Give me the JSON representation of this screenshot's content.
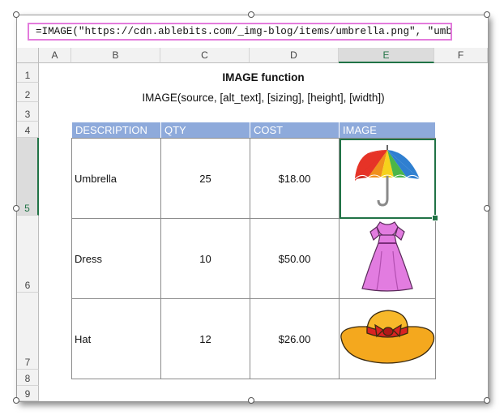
{
  "formula_bar": {
    "text": "=IMAGE(\"https://cdn.ablebits.com/_img-blog/items/umbrella.png\", \"umbrella\")"
  },
  "columns": [
    "A",
    "B",
    "C",
    "D",
    "E",
    "F"
  ],
  "selected_column": "E",
  "rows": [
    "1",
    "2",
    "3",
    "4",
    "5",
    "6",
    "7",
    "8",
    "9"
  ],
  "selected_row": "5",
  "sheet": {
    "title": "IMAGE function",
    "syntax": "IMAGE(source, [alt_text], [sizing], [height], [width])"
  },
  "table": {
    "headers": [
      "DESCRIPTION",
      "QTY",
      "COST",
      "IMAGE"
    ],
    "header_color": "#8eaadb",
    "rows": [
      {
        "description": "Umbrella",
        "qty": "25",
        "cost": "$18.00",
        "image_icon": "umbrella-icon"
      },
      {
        "description": "Dress",
        "qty": "10",
        "cost": "$50.00",
        "image_icon": "dress-icon"
      },
      {
        "description": "Hat",
        "qty": "12",
        "cost": "$26.00",
        "image_icon": "hat-icon"
      }
    ]
  },
  "colors": {
    "selection": "#217346",
    "formula_border": "#e37bdc"
  }
}
